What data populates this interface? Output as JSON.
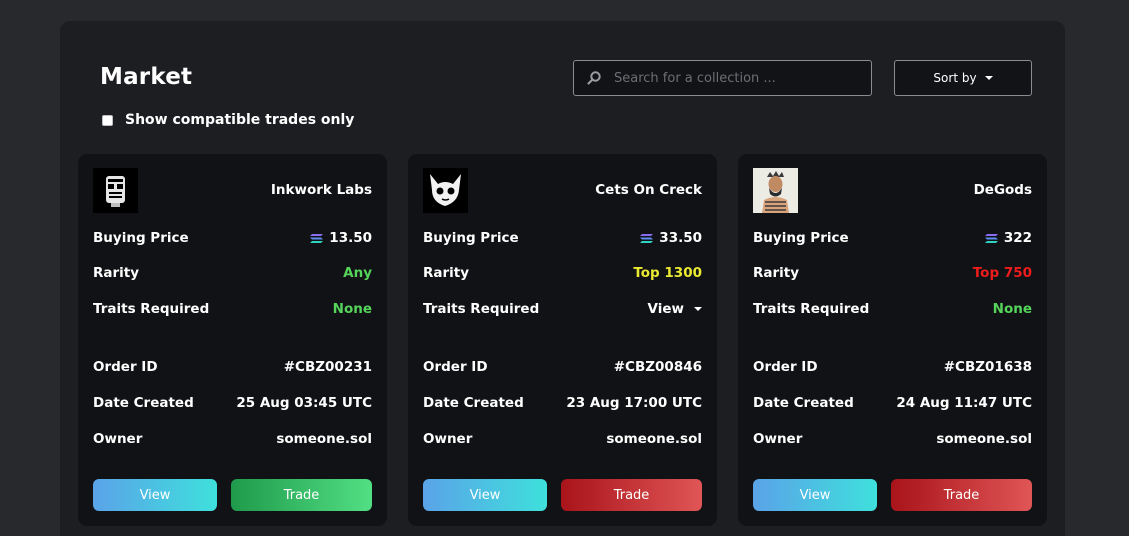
{
  "page": {
    "title": "Market",
    "compatible_label": "Show compatible trades only",
    "search_placeholder": "Search for a collection ...",
    "sort_label": "Sort by"
  },
  "labels": {
    "buying_price": "Buying Price",
    "rarity": "Rarity",
    "traits_required": "Traits Required",
    "order_id": "Order ID",
    "date_created": "Date Created",
    "owner": "Owner",
    "view": "View",
    "trade": "Trade"
  },
  "cards": [
    {
      "name": "Inkwork Labs",
      "price": "13.50",
      "rarity": "Any",
      "rarity_color": "#55d35a",
      "traits": "None",
      "order_id": "#CBZ00231",
      "date": "25 Aug 03:45 UTC",
      "owner": "someone.sol",
      "trade_style": "green"
    },
    {
      "name": "Cets On Creck",
      "price": "33.50",
      "rarity": "Top 1300",
      "rarity_color": "#eaea32",
      "traits": "View",
      "order_id": "#CBZ00846",
      "date": "23 Aug 17:00 UTC",
      "owner": "someone.sol",
      "trade_style": "red"
    },
    {
      "name": "DeGods",
      "price": "322",
      "rarity": "Top 750",
      "rarity_color": "#ee1c1c",
      "traits": "None",
      "order_id": "#CBZ01638",
      "date": "24 Aug 11:47 UTC",
      "owner": "someone.sol",
      "trade_style": "red"
    }
  ]
}
